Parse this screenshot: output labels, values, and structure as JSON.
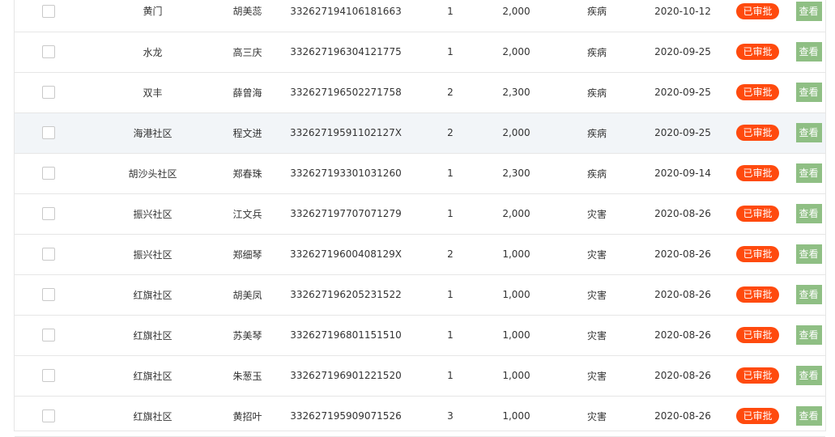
{
  "table": {
    "rows": [
      {
        "community": "黄门",
        "name": "胡美蕊",
        "id_number": "332627194106181663",
        "count": "1",
        "amount": "2,000",
        "reason": "疾病",
        "date": "2020-10-12",
        "status": "已审批",
        "action": "查看"
      },
      {
        "community": "水龙",
        "name": "高三庆",
        "id_number": "332627196304121775",
        "count": "1",
        "amount": "2,000",
        "reason": "疾病",
        "date": "2020-09-25",
        "status": "已审批",
        "action": "查看"
      },
      {
        "community": "双丰",
        "name": "薛曾海",
        "id_number": "332627196502271758",
        "count": "2",
        "amount": "2,300",
        "reason": "疾病",
        "date": "2020-09-25",
        "status": "已审批",
        "action": "查看"
      },
      {
        "community": "海港社区",
        "name": "程文进",
        "id_number": "33262719591102127X",
        "count": "2",
        "amount": "2,000",
        "reason": "疾病",
        "date": "2020-09-25",
        "status": "已审批",
        "action": "查看"
      },
      {
        "community": "胡沙头社区",
        "name": "郑春珠",
        "id_number": "332627193301031260",
        "count": "1",
        "amount": "2,300",
        "reason": "疾病",
        "date": "2020-09-14",
        "status": "已审批",
        "action": "查看"
      },
      {
        "community": "振兴社区",
        "name": "江文兵",
        "id_number": "332627197707071279",
        "count": "1",
        "amount": "2,000",
        "reason": "灾害",
        "date": "2020-08-26",
        "status": "已审批",
        "action": "查看"
      },
      {
        "community": "振兴社区",
        "name": "郑细琴",
        "id_number": "33262719600408129X",
        "count": "2",
        "amount": "1,000",
        "reason": "灾害",
        "date": "2020-08-26",
        "status": "已审批",
        "action": "查看"
      },
      {
        "community": "红旗社区",
        "name": "胡美凤",
        "id_number": "332627196205231522",
        "count": "1",
        "amount": "1,000",
        "reason": "灾害",
        "date": "2020-08-26",
        "status": "已审批",
        "action": "查看"
      },
      {
        "community": "红旗社区",
        "name": "苏美琴",
        "id_number": "332627196801151510",
        "count": "1",
        "amount": "1,000",
        "reason": "灾害",
        "date": "2020-08-26",
        "status": "已审批",
        "action": "查看"
      },
      {
        "community": "红旗社区",
        "name": "朱葱玉",
        "id_number": "332627196901221520",
        "count": "1",
        "amount": "1,000",
        "reason": "灾害",
        "date": "2020-08-26",
        "status": "已审批",
        "action": "查看"
      },
      {
        "community": "红旗社区",
        "name": "黄招叶",
        "id_number": "332627195909071526",
        "count": "3",
        "amount": "1,000",
        "reason": "灾害",
        "date": "2020-08-26",
        "status": "已审批",
        "action": "查看"
      }
    ]
  }
}
